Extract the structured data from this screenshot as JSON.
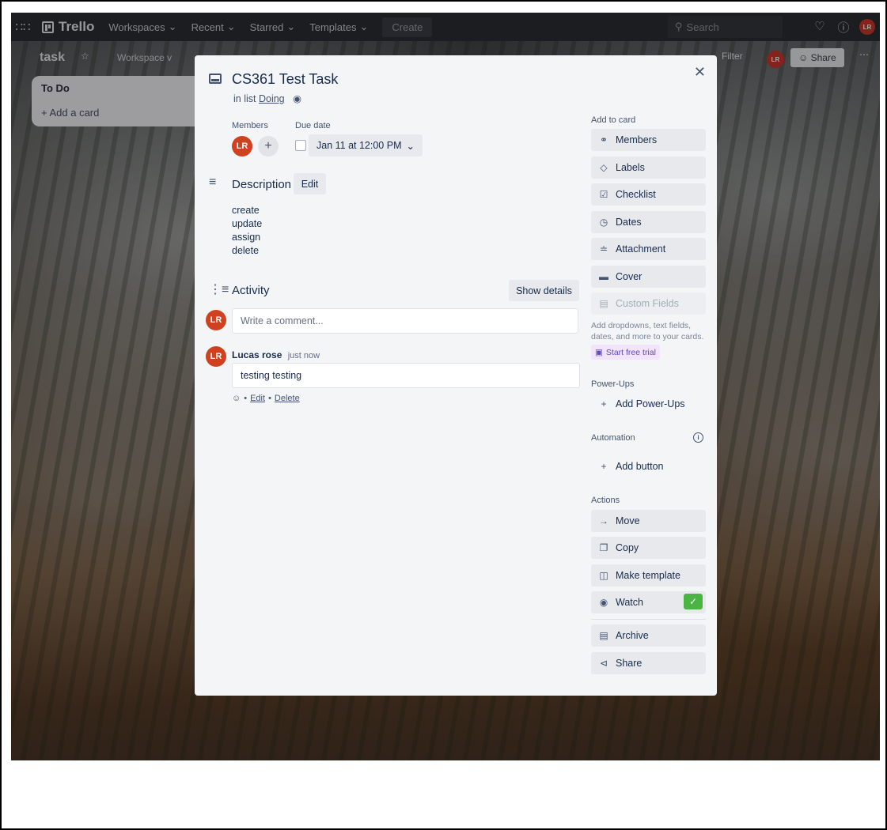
{
  "topnav": {
    "logo": "Trello",
    "workspaces": "Workspaces",
    "recent": "Recent",
    "starred": "Starred",
    "templates": "Templates",
    "create": "Create",
    "search_placeholder": "Search",
    "avatar_initials": "LR"
  },
  "board": {
    "title": "task",
    "visibility": "Workspace v",
    "filter": "Filter",
    "share": "Share",
    "avatar_initials": "LR"
  },
  "list": {
    "title": "To Do",
    "add_card": "+ Add a card"
  },
  "card": {
    "title": "CS361 Test Task",
    "in_list_prefix": "in list",
    "list_name": "Doing",
    "members_label": "Members",
    "member_initials": "LR",
    "due_label": "Due date",
    "due_value": "Jan 11 at 12:00 PM",
    "description_title": "Description",
    "edit_label": "Edit",
    "description_lines": [
      "create",
      "update",
      "assign",
      "delete"
    ],
    "activity_title": "Activity",
    "show_details": "Show details",
    "comment_placeholder": "Write a comment...",
    "comment": {
      "author": "Lucas rose",
      "time": "just now",
      "body": "testing testing",
      "edit": "Edit",
      "delete": "Delete",
      "initials": "LR"
    }
  },
  "sidebar": {
    "add_to_card": "Add to card",
    "add_items": [
      {
        "label": "Members",
        "icon": "person-icon"
      },
      {
        "label": "Labels",
        "icon": "tag-icon"
      },
      {
        "label": "Checklist",
        "icon": "checklist-icon"
      },
      {
        "label": "Dates",
        "icon": "clock-icon"
      },
      {
        "label": "Attachment",
        "icon": "paperclip-icon"
      },
      {
        "label": "Cover",
        "icon": "cover-icon"
      },
      {
        "label": "Custom Fields",
        "icon": "fields-icon"
      }
    ],
    "custom_fields_note": "Add dropdowns, text fields, dates, and more to your cards.",
    "start_trial": "Start free trial",
    "power_ups_label": "Power-Ups",
    "add_power_ups": "Add Power-Ups",
    "automation_label": "Automation",
    "add_button": "Add button",
    "actions_label": "Actions",
    "actions": [
      {
        "label": "Move",
        "icon": "arrow-right-icon"
      },
      {
        "label": "Copy",
        "icon": "copy-icon"
      },
      {
        "label": "Make template",
        "icon": "template-icon"
      },
      {
        "label": "Watch",
        "icon": "eye-icon"
      },
      {
        "label": "Archive",
        "icon": "archive-icon"
      },
      {
        "label": "Share",
        "icon": "share-icon"
      }
    ],
    "watch_active": true
  },
  "colors": {
    "avatar": "#d0421f",
    "watch_check": "#4bb543",
    "trial_bg": "#f3e3fb"
  }
}
